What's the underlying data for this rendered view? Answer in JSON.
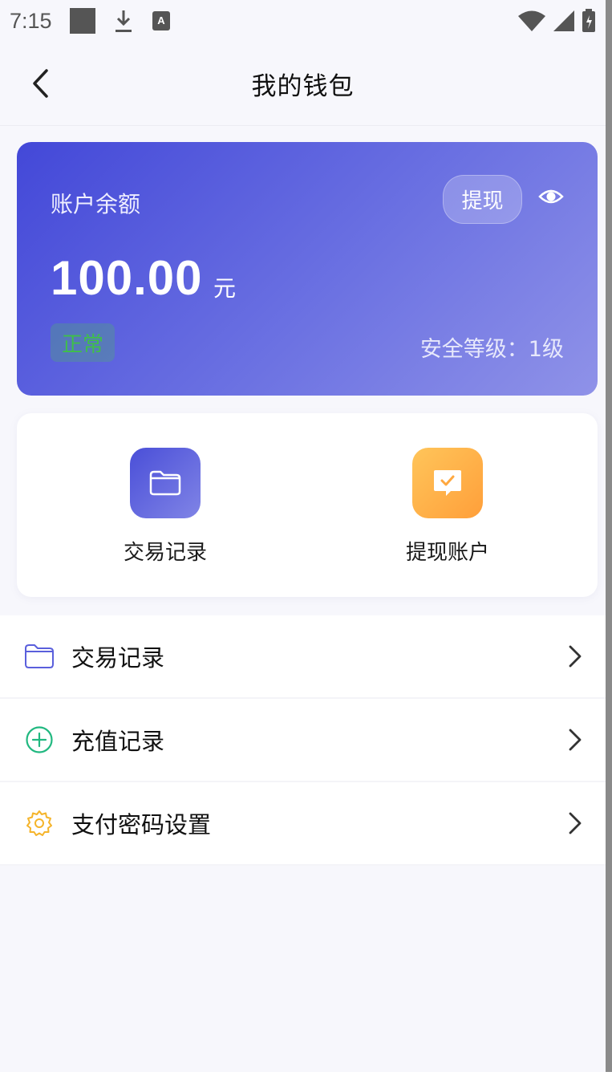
{
  "status_bar": {
    "time": "7:15",
    "left_icons": [
      "square-icon",
      "download-icon",
      "text-badge-icon"
    ],
    "right_icons": [
      "wifi-icon",
      "signal-icon",
      "battery-icon"
    ]
  },
  "header": {
    "title": "我的钱包",
    "back_icon": "chevron-left-icon"
  },
  "balance_card": {
    "label": "账户余额",
    "withdraw_label": "提现",
    "eye_icon": "eye-icon",
    "amount": "100.00",
    "unit": "元",
    "status": "正常",
    "security_level": "安全等级：1级",
    "colors": {
      "gradient_start": "#4348d8",
      "gradient_end": "#8f92e8",
      "status_green": "#3fbf4a"
    }
  },
  "quick_actions": [
    {
      "label": "交易记录",
      "icon": "folder-icon",
      "color": "#5a5fdc"
    },
    {
      "label": "提现账户",
      "icon": "chat-check-icon",
      "color": "#ffb04a"
    }
  ],
  "menu": [
    {
      "label": "交易记录",
      "icon": "folder-icon",
      "color": "#5a5fdc"
    },
    {
      "label": "充值记录",
      "icon": "plus-circle-icon",
      "color": "#21b880"
    },
    {
      "label": "支付密码设置",
      "icon": "gear-icon",
      "color": "#f5b42a"
    }
  ]
}
